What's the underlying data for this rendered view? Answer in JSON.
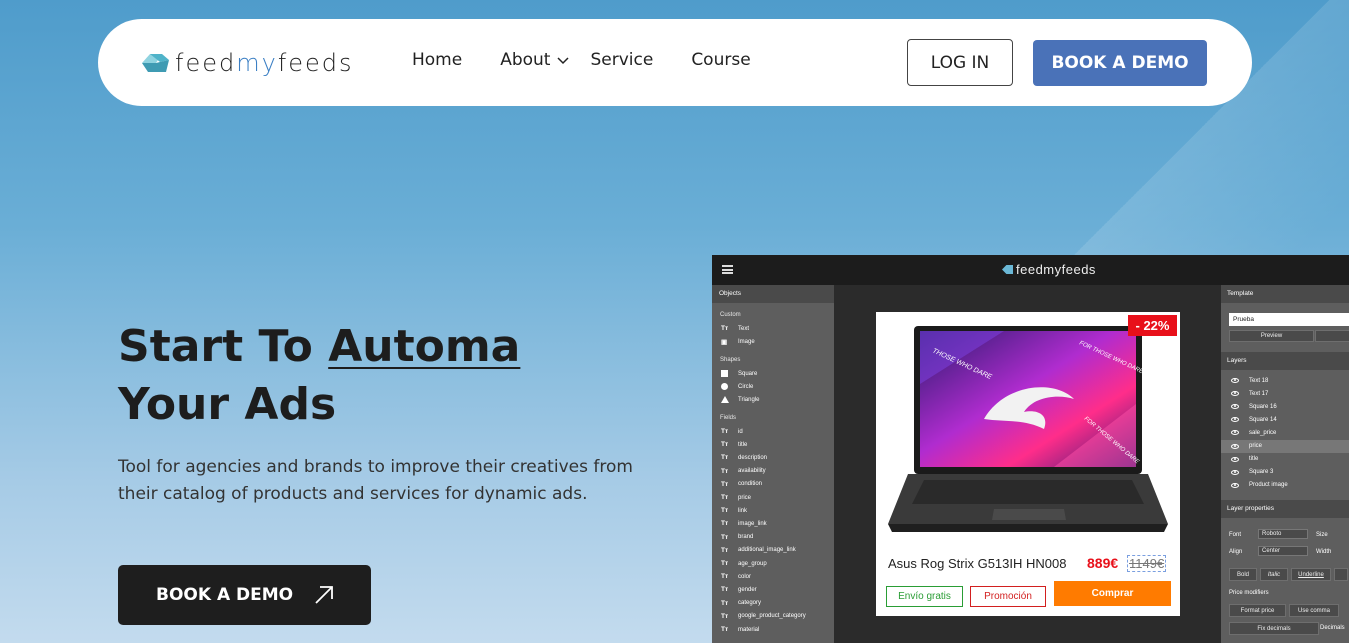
{
  "colors": {
    "accent": "#4a72b8",
    "brand_text_accent": "#3b7fc4",
    "dark_button": "#1e1e1e"
  },
  "nav": {
    "logo": {
      "part1": "feed",
      "part2": "my",
      "part3": "feeds",
      "icon": "logo-mark-icon"
    },
    "items": [
      {
        "label": "Home"
      },
      {
        "label": "About"
      },
      {
        "label": "Service"
      },
      {
        "label": "Course"
      }
    ],
    "login_label": "LOG IN",
    "demo_label": "BOOK A DEMO"
  },
  "hero": {
    "title_part1": "Start To ",
    "title_part2": "Automa",
    "title_line2": "Your Ads",
    "subtitle": "Tool for agencies and brands to improve their creatives from their catalog of products and services for dynamic ads.",
    "button_label": "BOOK A DEMO",
    "button_icon": "arrow-up-right-icon"
  },
  "app": {
    "logo": "feedmyfeeds",
    "left": {
      "objects_title": "Objects",
      "custom_label": "Custom",
      "custom_items": [
        "Text",
        "Image"
      ],
      "shapes_label": "Shapes",
      "shape_items": [
        "Square",
        "Circle",
        "Triangle"
      ],
      "fields_label": "Fields",
      "field_items": [
        "id",
        "title",
        "description",
        "availability",
        "condition",
        "price",
        "link",
        "image_link",
        "brand",
        "additional_image_link",
        "age_group",
        "color",
        "gender",
        "category",
        "google_product_category",
        "material"
      ]
    },
    "canvas": {
      "discount": "- 22%",
      "product_name": "Asus Rog Strix G513IH HN008",
      "price": "889€",
      "old_price": "1149€",
      "btn_free": "Envío gratis",
      "btn_promo": "Promoción",
      "btn_buy": "Comprar",
      "screen_text": [
        "THOSE WHO DARE",
        "FOR THOSE WHO DARE",
        "FOR THOSE WHO DARE"
      ]
    },
    "right": {
      "template_title": "Template",
      "template_value": "Prueba",
      "preview_label": "Preview",
      "layers_title": "Layers",
      "layers": [
        "Text 18",
        "Text 17",
        "Square 16",
        "Square 14",
        "sale_price",
        "price",
        "title",
        "Square 3",
        "Product image"
      ],
      "selected_layer": "price",
      "props_title": "Layer properties",
      "font_label": "Font",
      "font_value": "Roboto",
      "size_label": "Size",
      "align_label": "Align",
      "align_value": "Center",
      "width_label": "Width",
      "style_buttons": [
        "Bold",
        "Italic",
        "Underline"
      ],
      "price_modifiers_label": "Price modifiers",
      "format_price": "Format price",
      "use_comma": "Use comma",
      "fix_decimals": "Fix decimals",
      "decimals_label": "Decimals"
    }
  }
}
